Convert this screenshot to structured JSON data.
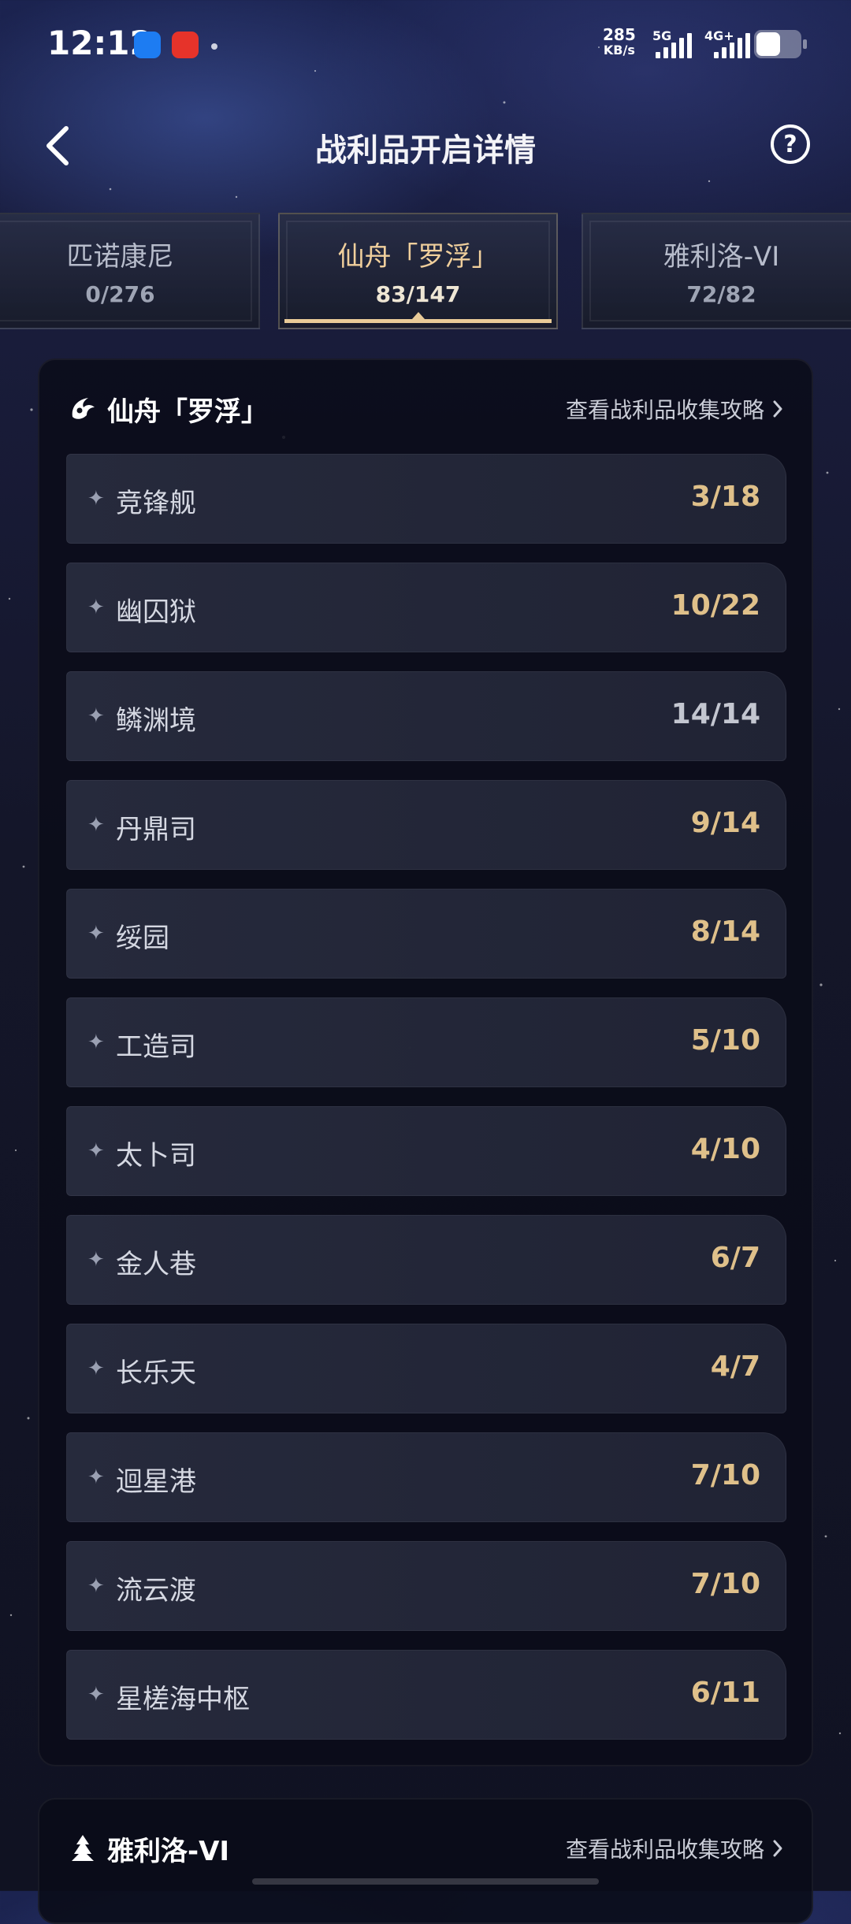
{
  "status_bar": {
    "time": "12:12",
    "net_speed_value": "285",
    "net_speed_unit": "KB/s",
    "network_1": "5G",
    "network_2": "4G+"
  },
  "header": {
    "title": "战利品开启详情",
    "back_icon": "back-chevron-icon",
    "help_icon": "help-icon",
    "help_glyph": "?"
  },
  "world_tabs": [
    {
      "name": "匹诺康尼",
      "count": "0/276",
      "active": false
    },
    {
      "name": "仙舟「罗浮」",
      "count": "83/147",
      "active": true
    },
    {
      "name": "雅利洛-VI",
      "count": "72/82",
      "active": false
    }
  ],
  "section": {
    "world_name": "仙舟「罗浮」",
    "guide_link": "查看战利品收集攻略",
    "areas": [
      {
        "name": "竞锋舰",
        "count": "3/18"
      },
      {
        "name": "幽囚狱",
        "count": "10/22"
      },
      {
        "name": "鳞渊境",
        "count": "14/14"
      },
      {
        "name": "丹鼎司",
        "count": "9/14"
      },
      {
        "name": "绥园",
        "count": "8/14"
      },
      {
        "name": "工造司",
        "count": "5/10"
      },
      {
        "name": "太卜司",
        "count": "4/10"
      },
      {
        "name": "金人巷",
        "count": "6/7"
      },
      {
        "name": "长乐天",
        "count": "4/7"
      },
      {
        "name": "迴星港",
        "count": "7/10"
      },
      {
        "name": "流云渡",
        "count": "7/10"
      },
      {
        "name": "星槎海中枢",
        "count": "6/11"
      }
    ]
  },
  "section2": {
    "world_name": "雅利洛-VI",
    "guide_link": "查看战利品收集攻略"
  },
  "colors": {
    "accent_gold": "#dfc08a",
    "tab_active_text": "#f0cf9c",
    "complete_count": "#c3c6d0"
  }
}
